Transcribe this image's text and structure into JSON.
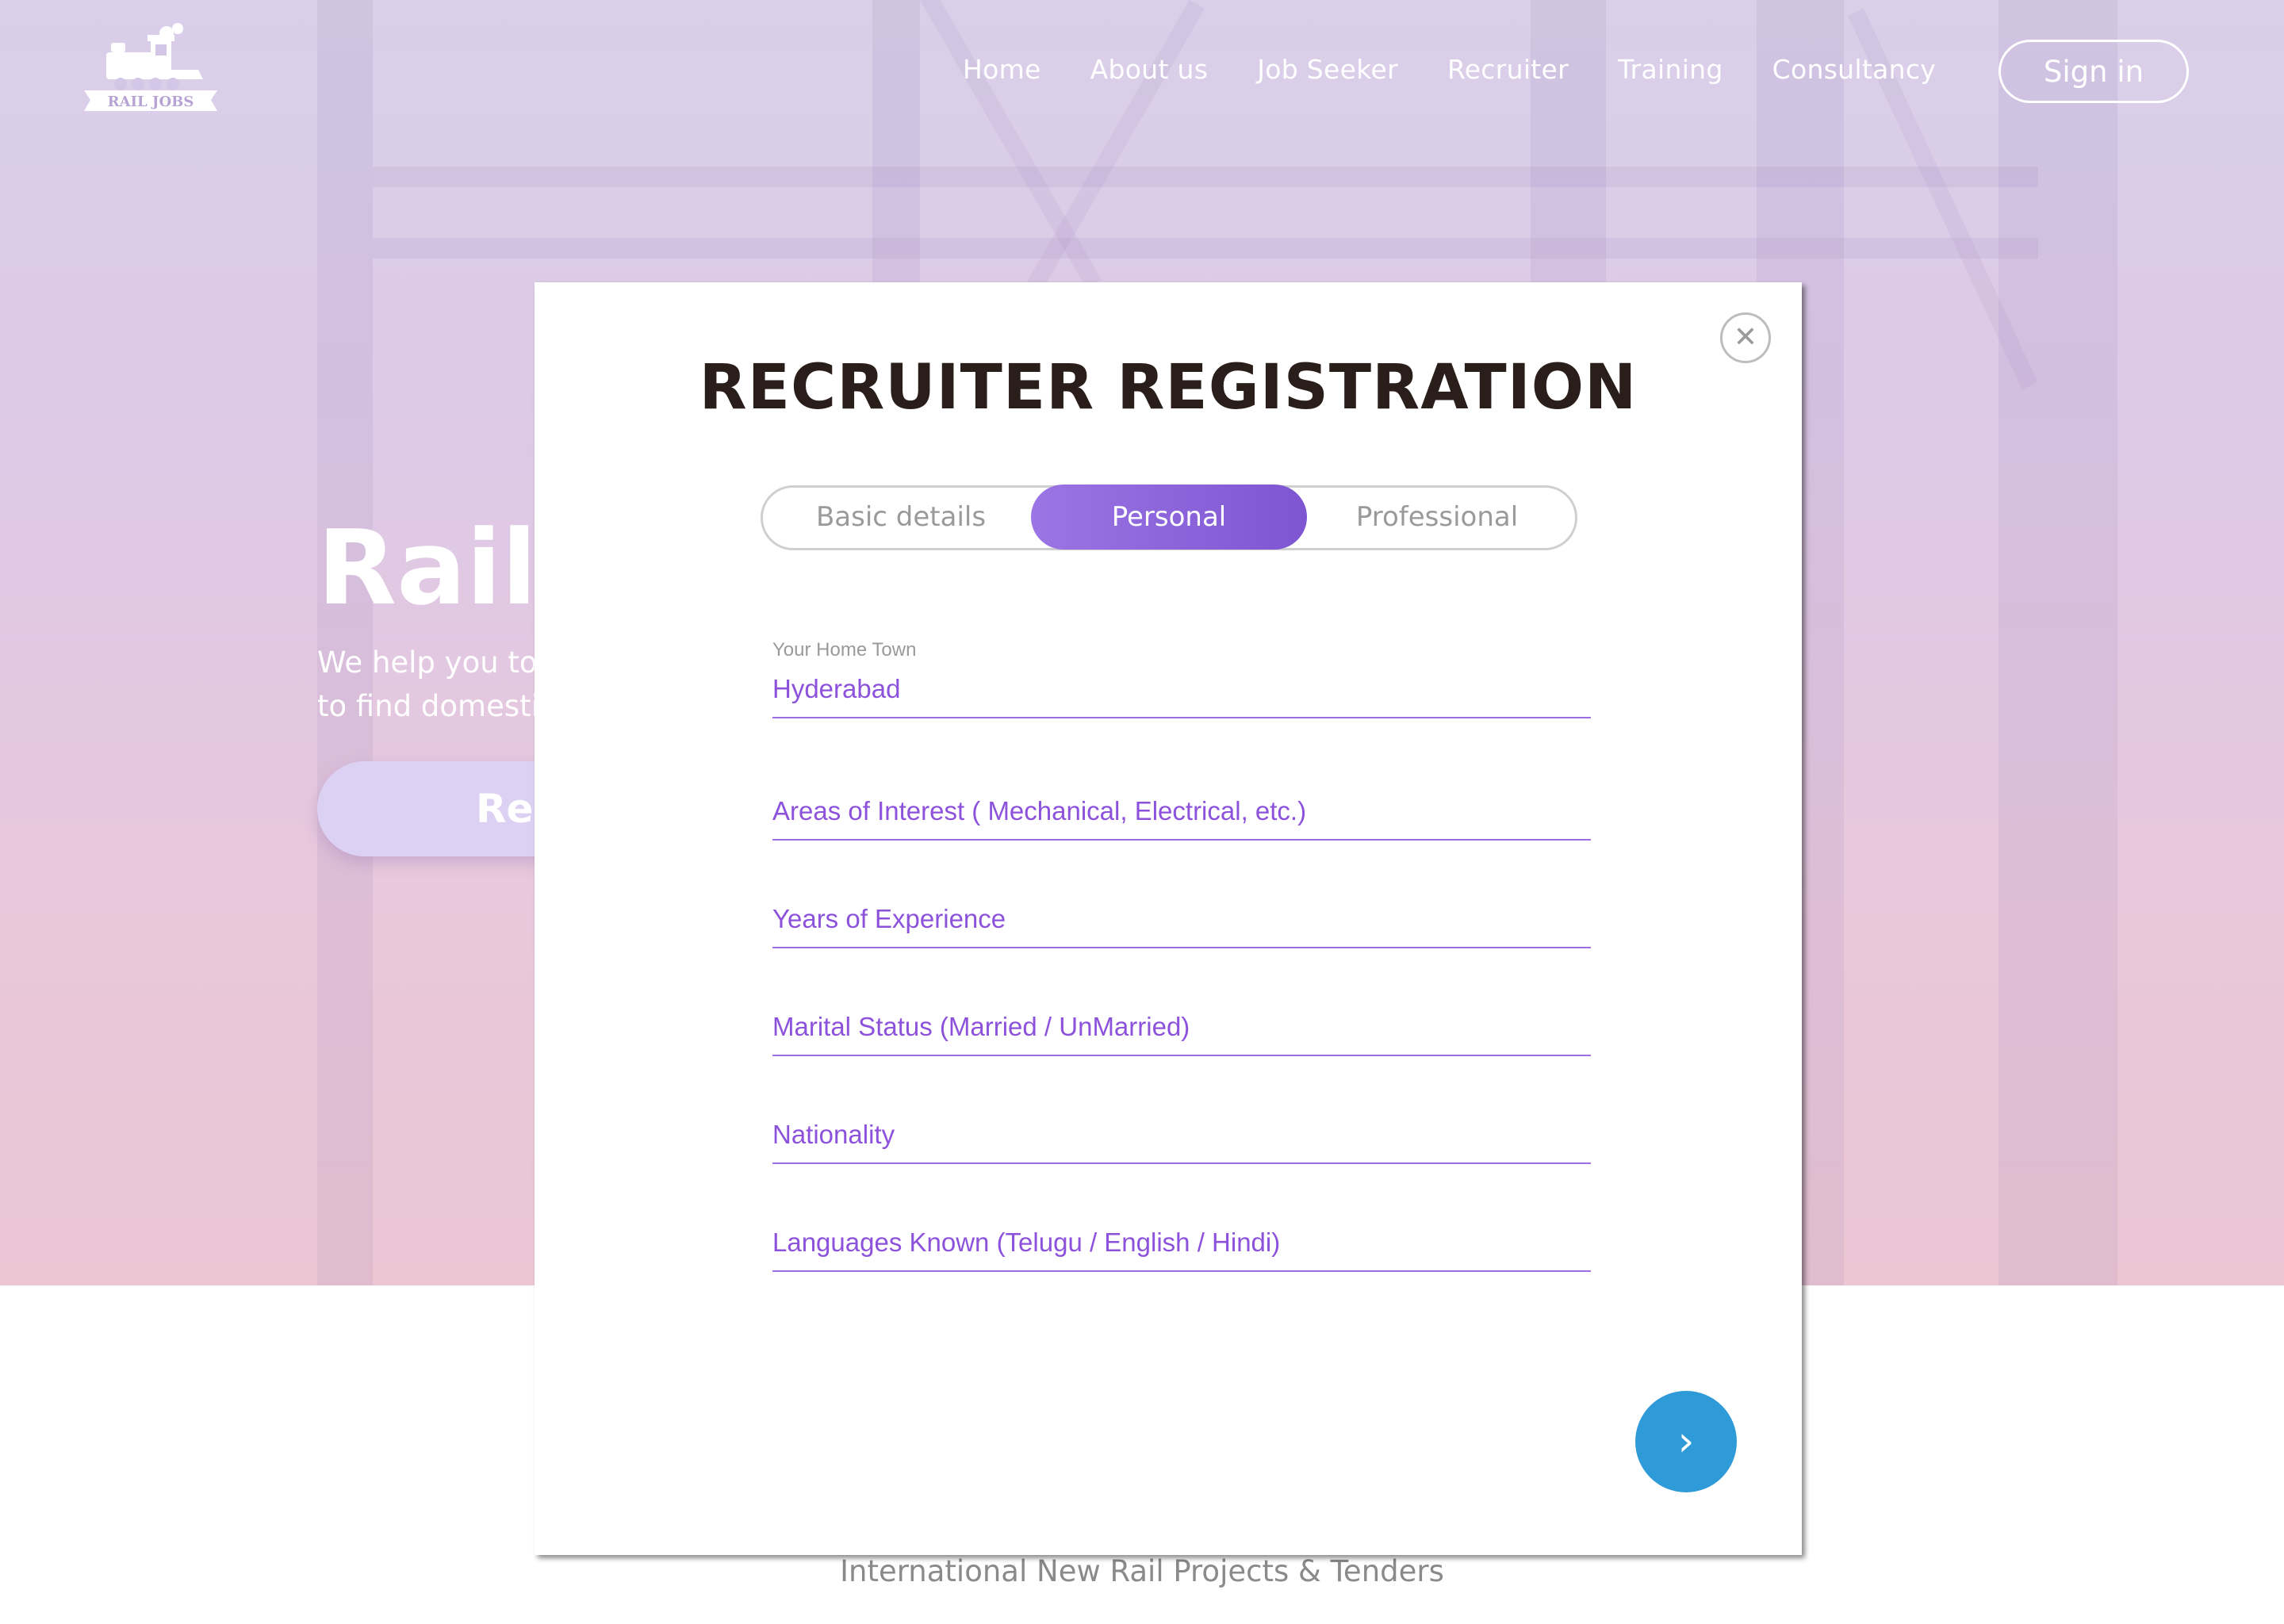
{
  "brand": {
    "logo_text": "RAIL JOBS"
  },
  "nav": {
    "items": [
      "Home",
      "About us",
      "Job Seeker",
      "Recruiter",
      "Training",
      "Consultancy"
    ],
    "signin_label": "Sign in"
  },
  "hero": {
    "title": "Rail J",
    "subtitle_line1": "We help you to",
    "subtitle_line2": "to find domesti",
    "button_label": "Reg"
  },
  "modal": {
    "title": "RECRUITER REGISTRATION",
    "close_glyph": "✕",
    "tabs": [
      "Basic details",
      "Personal",
      "Professional"
    ],
    "active_tab": "Personal",
    "fields": {
      "home_town": {
        "label": "Your Home Town",
        "value": "Hyderabad"
      },
      "areas_of_interest": {
        "placeholder": "Areas of Interest ( Mechanical, Electrical, etc.)"
      },
      "experience": {
        "placeholder": "Years of Experience"
      },
      "marital_status": {
        "placeholder": "Marital Status (Married / UnMarried)"
      },
      "nationality": {
        "placeholder": "Nationality"
      },
      "languages": {
        "placeholder": "Languages Known (Telugu / English / Hindi)"
      }
    },
    "next_glyph": "›"
  },
  "footer": {
    "text": "International New Rail Projects & Tenders"
  },
  "colors": {
    "accent_purple": "#8d52dc",
    "tab_active": "#7e55d2",
    "next_button": "#2e9ad8"
  }
}
